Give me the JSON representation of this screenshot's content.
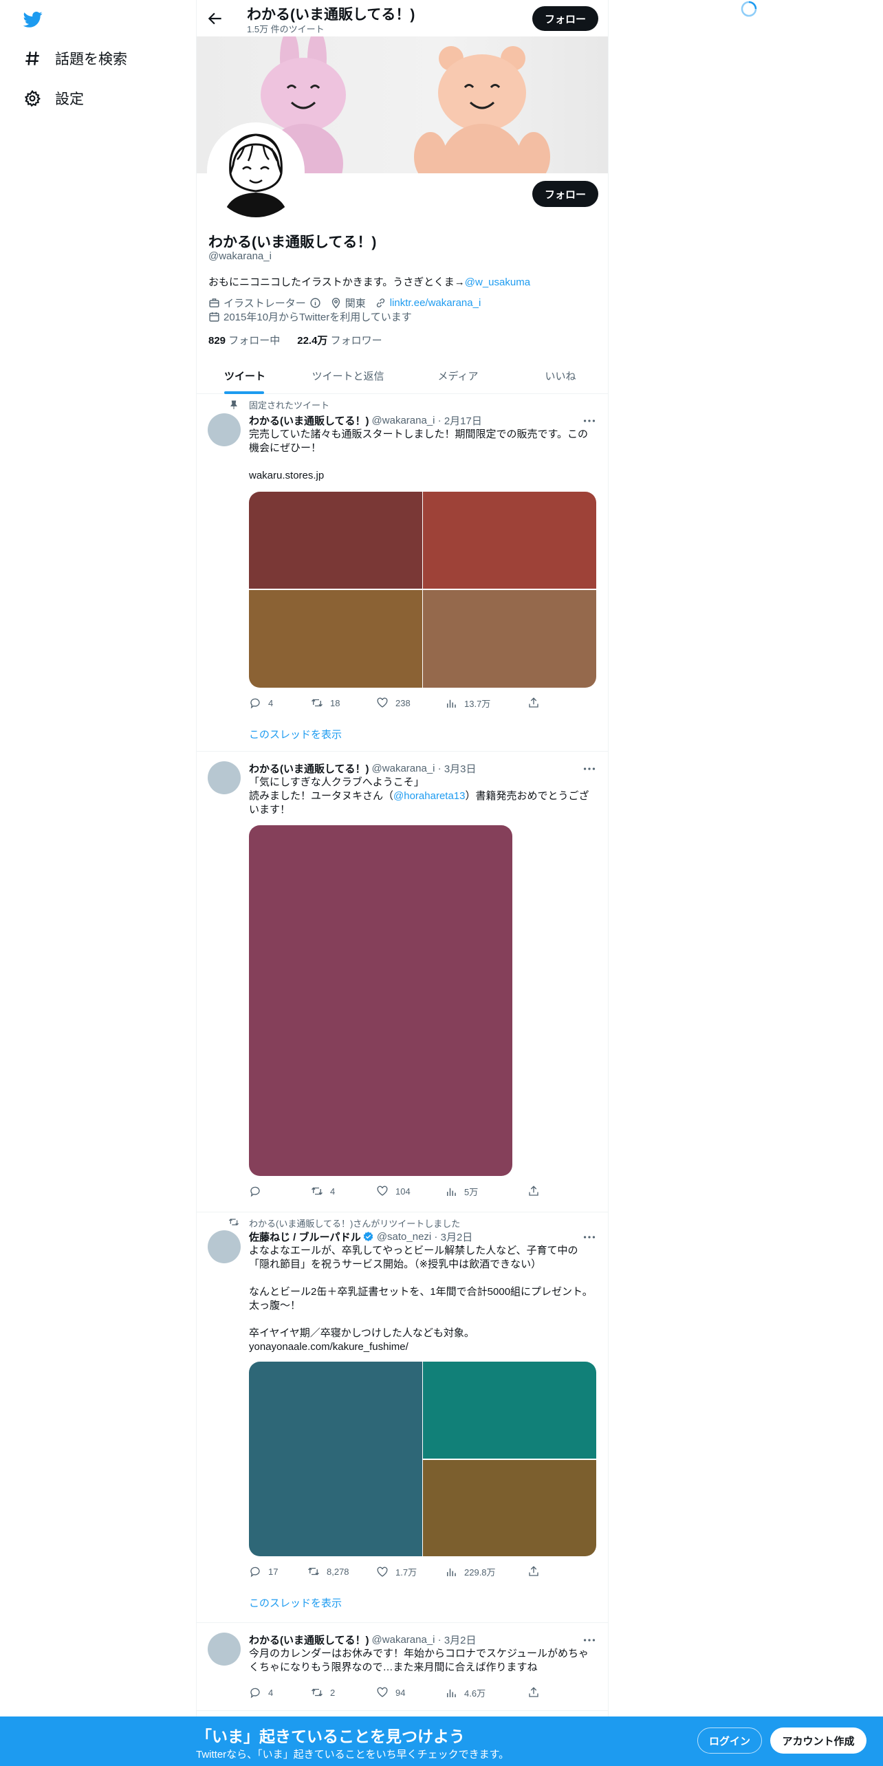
{
  "nav": {
    "explore_label": "話題を検索",
    "settings_label": "設定"
  },
  "profile": {
    "name": "わかる(いま通販してる！)",
    "tweet_count": "1.5万 件のツイート",
    "follow_label": "フォロー",
    "handle": "@wakarana_i",
    "bio": "おもにニコニコしたイラストかきます。うさぎとくま→",
    "bio_link": "@w_usakuma",
    "category": "イラストレーター",
    "location": "関東",
    "website": "linktr.ee/wakarana_i",
    "joined": "2015年10月からTwitterを利用しています",
    "following_count": "829",
    "following_label": "フォロー中",
    "followers_count": "22.4万",
    "followers_label": "フォロワー"
  },
  "tabs": [
    {
      "label": "ツイート"
    },
    {
      "label": "ツイートと返信"
    },
    {
      "label": "メディア"
    },
    {
      "label": "いいね"
    }
  ],
  "tweets": [
    {
      "social": "固定されたツイート",
      "name": "わかる(いま通販してる！)",
      "handle": "@wakarana_i",
      "date": "2月17日",
      "text": "完売していた諸々も通販スタートしました！期間限定での販売です。この機会にぜひー！",
      "link": "wakaru.stores.jp",
      "reply": "4",
      "retweet": "18",
      "like": "238",
      "views": "13.7万",
      "thread": "このスレッドを表示",
      "colors": [
        "#7a3836",
        "#9e4238",
        "#8b6234",
        "#95694c"
      ]
    },
    {
      "name": "わかる(いま通販してる！)",
      "handle": "@wakarana_i",
      "date": "3月3日",
      "text1": "「気にしすぎな人クラブへようこそ」\n読みました！ユータヌキさん（",
      "mention": "@horahareta13",
      "text2": "）書籍発売おめでとうございます！",
      "reply": "",
      "retweet": "4",
      "like": "104",
      "views": "5万",
      "colors": [
        "#85405a"
      ]
    },
    {
      "social": "わかる(いま通販してる！)さんがリツイートしました",
      "name": "佐藤ねじ / ブルーパドル",
      "handle": "@sato_nezi",
      "date": "3月2日",
      "text": "よなよなエールが、卒乳してやっとビール解禁した人など、子育て中の「隠れ節目」を祝うサービス開始。（※授乳中は飲酒できない）\n\nなんとビール2缶＋卒乳証書セットを、1年間で合計5000組にプレゼント。太っ腹〜！\n\n卒イヤイヤ期／卒寝かしつけした人なども対象。",
      "link": "yonayonaale.com/kakure_fushime/",
      "reply": "17",
      "retweet": "8,278",
      "like": "1.7万",
      "views": "229.8万",
      "thread": "このスレッドを表示",
      "colors": [
        "#2e6777",
        "#118078",
        "#7c5f2e"
      ]
    },
    {
      "name": "わかる(いま通販してる！)",
      "handle": "@wakarana_i",
      "date": "3月2日",
      "text": "今月のカレンダーはお休みです！年始からコロナでスケジュールがめちゃくちゃになりもう限界なので…また来月間に合えば作りますね",
      "reply": "4",
      "retweet": "2",
      "like": "94",
      "views": "4.6万"
    }
  ],
  "bottom": {
    "title": "「いま」起きていることを見つけよう",
    "subtitle": "Twitterなら、「いま」起きていることをいち早くチェックできます。",
    "login": "ログイン",
    "signup": "アカウント作成"
  },
  "colors": {
    "accent": "#1d9bf0",
    "text": "#0f1419",
    "muted": "#536471"
  }
}
